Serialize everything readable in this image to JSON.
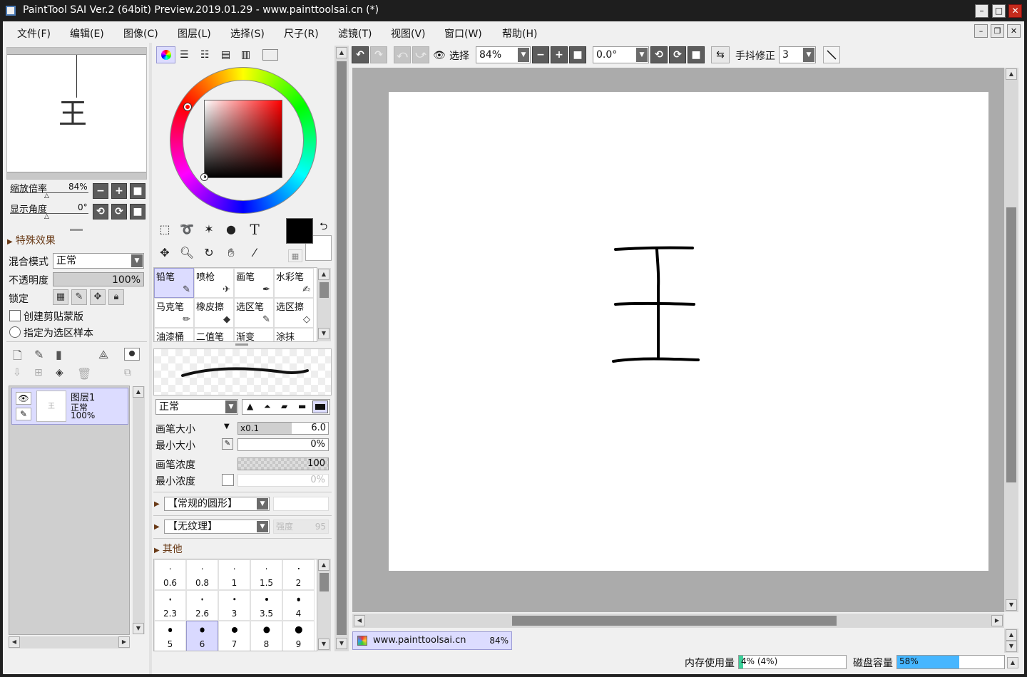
{
  "window": {
    "title": "PaintTool SAI Ver.2 (64bit) Preview.2019.01.29 - www.painttoolsai.cn (*)"
  },
  "menu": [
    "文件(F)",
    "编辑(E)",
    "图像(C)",
    "图层(L)",
    "选择(S)",
    "尺子(R)",
    "滤镜(T)",
    "视图(V)",
    "窗口(W)",
    "帮助(H)"
  ],
  "navigator": {
    "preview_char": "王",
    "zoom_label": "缩放倍率",
    "zoom_value": "84%",
    "angle_label": "显示角度",
    "angle_value": "0°"
  },
  "layer_props": {
    "effects_label": "特殊效果",
    "blend_label": "混合模式",
    "blend_value": "正常",
    "opacity_label": "不透明度",
    "opacity_value": "100%",
    "lock_label": "锁定",
    "clip_label": "创建剪贴蒙版",
    "sample_label": "指定为选区样本"
  },
  "layers": [
    {
      "name": "图层1",
      "mode": "正常",
      "opacity": "100%"
    }
  ],
  "color": {
    "current": "#000000",
    "secondary": "#ffffff"
  },
  "brushes": [
    {
      "label": "铅笔",
      "icon": "✎",
      "selected": true
    },
    {
      "label": "喷枪",
      "icon": "✈",
      "selected": false
    },
    {
      "label": "画笔",
      "icon": "✒",
      "selected": false
    },
    {
      "label": "水彩笔",
      "icon": "✍",
      "selected": false
    },
    {
      "label": "马克笔",
      "icon": "✏",
      "selected": false
    },
    {
      "label": "橡皮擦",
      "icon": "◆",
      "selected": false
    },
    {
      "label": "选区笔",
      "icon": "✎",
      "selected": false
    },
    {
      "label": "选区擦",
      "icon": "◇",
      "selected": false
    },
    {
      "label": "油漆桶",
      "icon": "",
      "selected": false
    },
    {
      "label": "二值笔",
      "icon": "",
      "selected": false
    },
    {
      "label": "渐变",
      "icon": "",
      "selected": false
    },
    {
      "label": "涂抹",
      "icon": "",
      "selected": false
    }
  ],
  "brush_settings": {
    "mode_value": "正常",
    "size_label": "画笔大小",
    "size_multiplier": "x0.1",
    "size_value": "6.0",
    "minsize_label": "最小大小",
    "minsize_value": "0%",
    "density_label": "画笔浓度",
    "density_value": "100",
    "mindensity_label": "最小浓度",
    "mindensity_value": "0%",
    "shape_value": "【常规的圆形】",
    "texture_value": "【无纹理】",
    "texture_strength_label": "强度",
    "texture_strength_value": "95",
    "other_label": "其他"
  },
  "size_presets": [
    "0.6",
    "0.8",
    "1",
    "1.5",
    "2",
    "2.3",
    "2.6",
    "3",
    "3.5",
    "4",
    "5",
    "6",
    "7",
    "8",
    "9"
  ],
  "size_preset_selected": "6",
  "toolbar": {
    "select_label": "选择",
    "zoom_value": "84%",
    "angle_value": "0.0°",
    "stabilizer_label": "手抖修正",
    "stabilizer_value": "3"
  },
  "document_tab": {
    "name": "www.painttoolsai.cn",
    "zoom": "84%"
  },
  "status": {
    "memory_label": "内存使用量",
    "memory_value": "4% (4%)",
    "memory_fraction": 0.04,
    "disk_label": "磁盘容量",
    "disk_value": "58%",
    "disk_fraction": 0.58
  }
}
